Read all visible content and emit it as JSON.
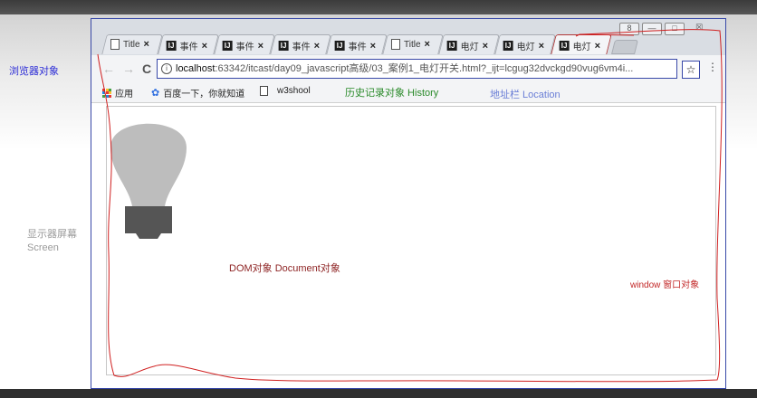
{
  "side_labels": {
    "browser_object": "浏览器对象",
    "screen_object_line1": "显示器屏幕",
    "screen_object_line2": "Screen"
  },
  "window_controls": {
    "user": "8",
    "minimize": "—",
    "maximize": "□",
    "close": "☒"
  },
  "tabs": [
    {
      "icon": "doc-icon",
      "title": "Title",
      "close": "×"
    },
    {
      "icon": "intellij-icon",
      "title": "事件",
      "close": "×"
    },
    {
      "icon": "intellij-icon",
      "title": "事件",
      "close": "×"
    },
    {
      "icon": "intellij-icon",
      "title": "事件",
      "close": "×"
    },
    {
      "icon": "intellij-icon",
      "title": "事件",
      "close": "×"
    },
    {
      "icon": "doc-icon",
      "title": "Title",
      "close": "×"
    },
    {
      "icon": "intellij-icon",
      "title": "电灯",
      "close": "×"
    },
    {
      "icon": "intellij-icon",
      "title": "电灯",
      "close": "×"
    },
    {
      "icon": "intellij-icon",
      "title": "电灯",
      "close": "×",
      "active": true
    }
  ],
  "toolbar": {
    "back": "←",
    "forward": "→",
    "reload": "C",
    "info": "i",
    "url_host": "localhost",
    "url_rest": ":63342/itcast/day09_javascript高级/03_案例1_电灯开关.html?_ijt=lcgug32dvckgd90vug6vm4i...",
    "star": "☆",
    "menu": "⋮"
  },
  "bookmarks": {
    "apps": "应用",
    "baidu": "百度一下，你就知道",
    "w3school": "w3shool"
  },
  "annotations": {
    "history": "历史记录对象 History",
    "location": "地址栏 Location",
    "dom": "DOM对象 Document对象",
    "window": "window 窗口对象"
  },
  "colors": {
    "annotation_red": "#c22626",
    "frame_blue": "#3848a8",
    "history_green": "#2a8a2a",
    "location_blue": "#6a7ed6",
    "bulb_gray": "#bdbdbd",
    "bulb_base": "#555555"
  }
}
